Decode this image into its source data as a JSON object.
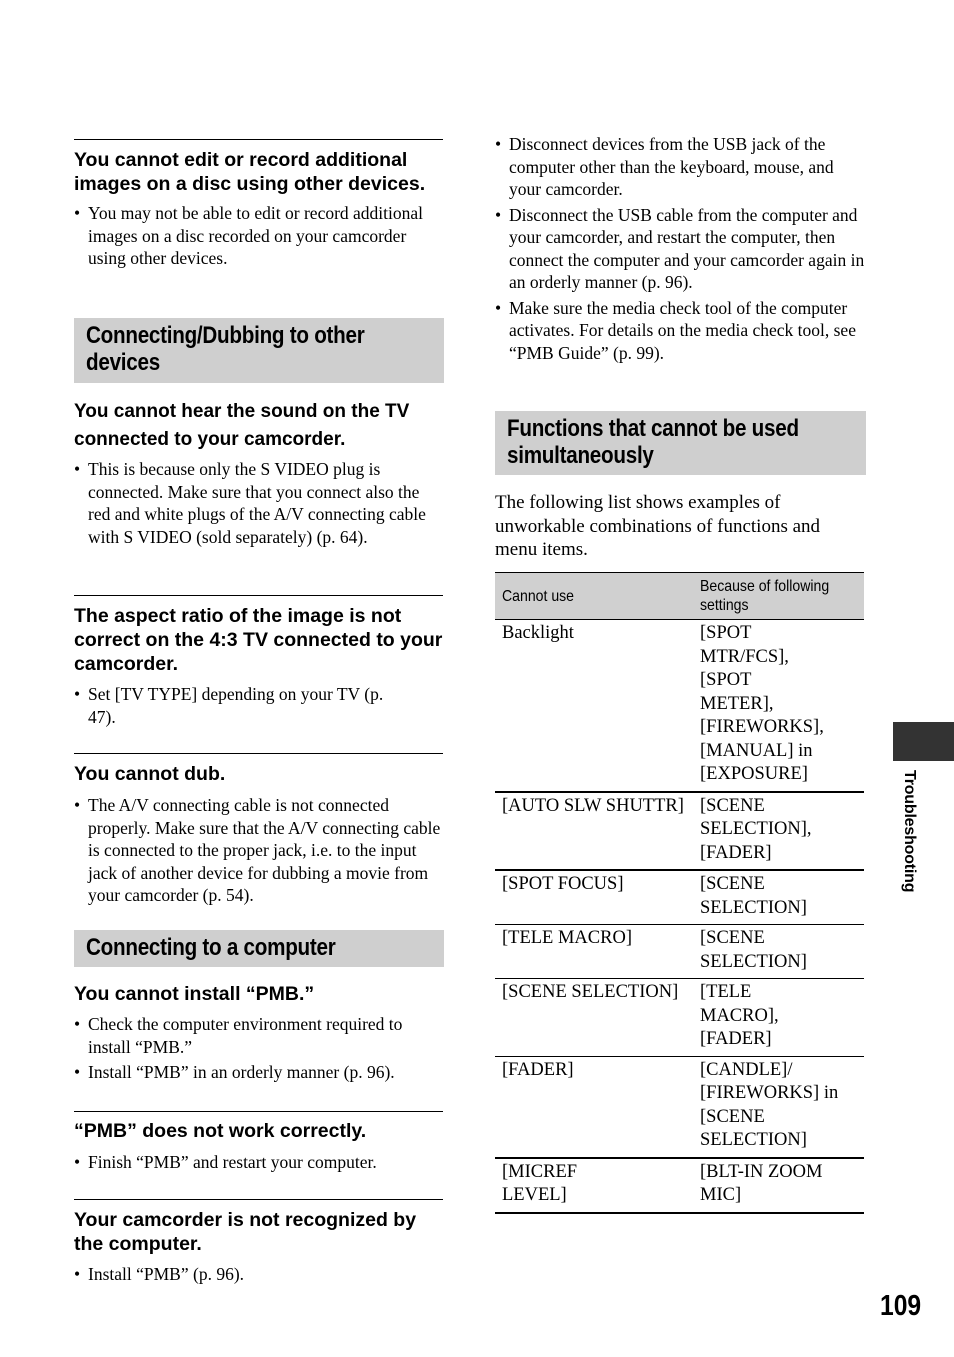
{
  "left": {
    "s1": {
      "heading": "You cannot edit or record additional images on a disc using other devices.",
      "bullets": [
        "You may not be able to edit or record additional images on a disc recorded on your camcorder using other devices."
      ]
    },
    "band1": "Connecting/Dubbing to other devices",
    "s2": {
      "heading": "You cannot hear the sound on the TV connected to your camcorder.",
      "bullets": [
        "This is because only the S VIDEO plug is connected. Make sure that you connect also the red and white plugs of the A/V connecting cable with S VIDEO (sold separately) (p. 64)."
      ]
    },
    "s3": {
      "heading": "The aspect ratio of the image is not correct on the 4:3 TV connected to your camcorder.",
      "bullets": [
        "Set [TV TYPE] depending on your TV (p. 47)."
      ]
    },
    "s4": {
      "heading": "You cannot dub.",
      "bullets": [
        "The A/V connecting cable is not connected properly. Make sure that the A/V connecting cable is connected to the proper jack, i.e. to the input jack of another device for dubbing a movie from your camcorder (p. 54)."
      ]
    },
    "band2": "Connecting to a computer",
    "s5": {
      "heading": "You cannot install “PMB.”",
      "bullets": [
        "Check the computer environment required to install “PMB.”",
        "Install “PMB” in an orderly manner (p. 96)."
      ]
    },
    "s6": {
      "heading": "“PMB” does not work correctly.",
      "bullets": [
        "Finish “PMB” and restart your computer."
      ]
    },
    "s7": {
      "heading": "Your camcorder is not recognized by the computer.",
      "bullets": [
        "Install “PMB” (p. 96)."
      ]
    }
  },
  "right": {
    "bullets": [
      "Disconnect devices from the USB jack of the computer other than the keyboard, mouse, and your camcorder.",
      "Disconnect the USB cable from the computer and your camcorder, and restart the computer, then connect the computer and your camcorder again in an orderly manner (p. 96).",
      "Make sure the media check tool of the computer activates. For details on the media check tool, see “PMB Guide” (p. 99)."
    ],
    "band": "Functions that cannot be used simultaneously",
    "intro": "The following list shows examples of unworkable combinations of functions and menu items.",
    "table": {
      "headers": [
        "Cannot use",
        "Because of following settings"
      ],
      "rows": [
        [
          "Backlight",
          "[SPOT MTR/FCS], [SPOT METER], [FIREWORKS], [MANUAL] in [EXPOSURE]"
        ],
        [
          "[AUTO SLW SHUTTR]",
          "[SCENE SELECTION], [FADER]"
        ],
        [
          "[SPOT FOCUS]",
          "[SCENE SELECTION]"
        ],
        [
          "[TELE MACRO]",
          "[SCENE SELECTION]"
        ],
        [
          "[SCENE SELECTION]",
          "[TELE MACRO], [FADER]"
        ],
        [
          "[FADER]",
          "[CANDLE]/ [FIREWORKS] in [SCENE SELECTION]"
        ],
        [
          "[MICREF LEVEL]",
          "[BLT-IN ZOOM MIC]"
        ]
      ]
    }
  },
  "side_tab": {
    "label": "Troubleshooting",
    "color": "#333333"
  },
  "page_number": "109"
}
